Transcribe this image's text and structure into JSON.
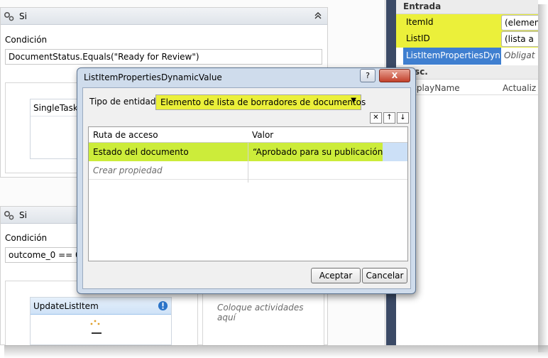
{
  "designer": {
    "activity1": {
      "title": "Si",
      "condition_label": "Condición",
      "condition_value": "DocumentStatus.Equals(\"Ready for Review\")"
    },
    "single_task": {
      "title": "SingleTask"
    },
    "activity2": {
      "title": "Si",
      "condition_label": "Condición",
      "condition_value": "outcome_0 == 0"
    },
    "update_item": {
      "title": "UpdateListItem"
    },
    "drop_hint": "Coloque actividades aquí"
  },
  "properties": {
    "group_input": "Entrada",
    "rows": [
      {
        "name": "ItemId",
        "value": "(elemen"
      },
      {
        "name": "ListID",
        "value": "(lista a"
      },
      {
        "name": "ListItemPropertiesDyn...",
        "value": "Obligat"
      }
    ],
    "group_misc": "Misc.",
    "grid_col1": "DisplayName",
    "grid_col2": "Actualiz"
  },
  "dialog": {
    "title": "ListItemPropertiesDynamicValue",
    "help_label": "?",
    "close_label": "X",
    "entity_label": "Tipo de entidad",
    "entity_value": "Elemento de lista de borradores de documentos",
    "delete_glyph": "✕",
    "up_glyph": "↑",
    "down_glyph": "↓",
    "columns": [
      "Ruta de acceso",
      "Valor"
    ],
    "rows": [
      {
        "path": "Estado del documento",
        "value": "“Aprobado para su publicación”"
      }
    ],
    "new_row_placeholder": "Crear propiedad",
    "ok_label": "Aceptar",
    "cancel_label": "Cancelar"
  },
  "colors": {
    "highlight_yellow": "#ebf03a",
    "selection_blue": "#3f7fd0",
    "grid_highlight": "#ccec3a"
  }
}
